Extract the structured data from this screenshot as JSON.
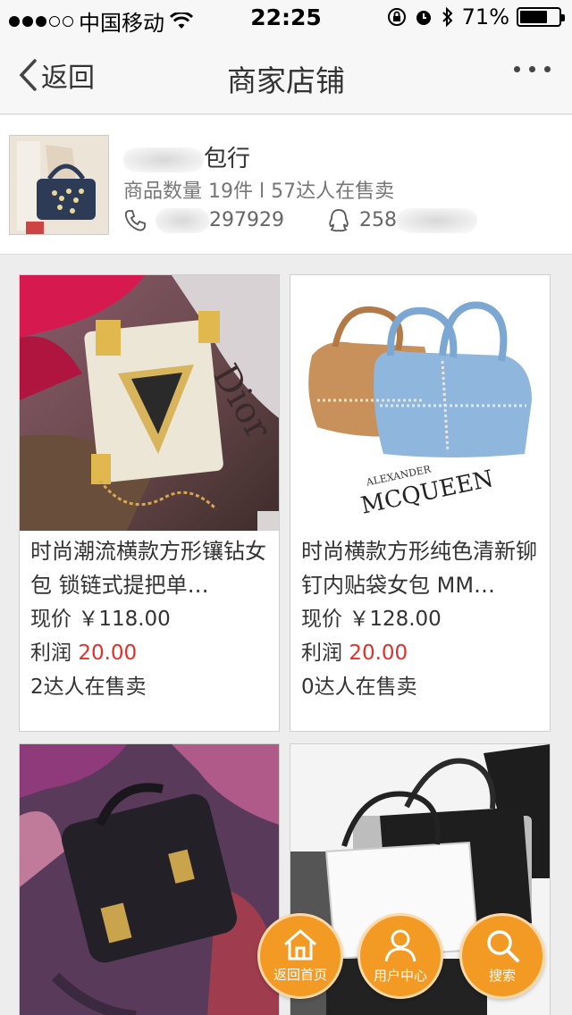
{
  "status_bar": {
    "carrier": "中国移动",
    "time": "22:25",
    "battery_percent": "71%",
    "battery_level": 0.71
  },
  "nav": {
    "back_label": "返回",
    "title": "商家店铺"
  },
  "shop": {
    "name_visible": "包行",
    "meta": "商品数量 19件 l 57达人在售卖",
    "phone_visible": "297929",
    "qq_visible": "258"
  },
  "products": [
    {
      "title": "时尚潮流横款方形镶钻女包 锁链式提把单…",
      "price_label": "现价",
      "price": "￥118.00",
      "profit_label": "利润",
      "profit": "20.00",
      "sellers": "2达人在售卖"
    },
    {
      "title": "时尚横款方形纯色清新铆钉内贴袋女包 MM…",
      "price_label": "现价",
      "price": "￥128.00",
      "profit_label": "利润",
      "profit": "20.00",
      "sellers": "0达人在售卖",
      "image_text": "ALEXANDER MCQUEEN"
    }
  ],
  "fabs": {
    "home": "返回首页",
    "user": "用户中心",
    "search": "搜索"
  },
  "colors": {
    "accent": "#f39a25",
    "profit_red": "#e0302a"
  }
}
